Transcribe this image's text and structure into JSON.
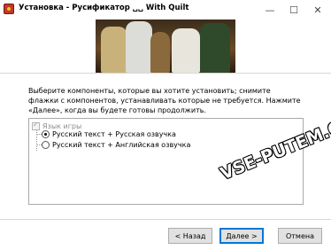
{
  "window": {
    "title": "Установка - Русификатор ␣␣ With Quilt",
    "controls": {
      "minimize": "—",
      "maximize": "☐",
      "close": "✕"
    }
  },
  "banner": {
    "icon": "game-cover-art"
  },
  "description": "Выберите компоненты, которые вы хотите установить; снимите флажки с компонентов, устанавливать которые не требуется. Нажмите «Далее», когда вы будете готовы продолжить.",
  "components": {
    "parent": {
      "label": "Язык игры",
      "checked": true,
      "disabled": true
    },
    "options": [
      {
        "label": "Русский текст + Русская озвучка",
        "selected": true
      },
      {
        "label": "Русский текст + Английская озвучка",
        "selected": false
      }
    ]
  },
  "watermark": "VSE-PUTEM.COM",
  "buttons": {
    "back": "< Назад",
    "next": "Далее >",
    "cancel": "Отмена"
  },
  "colors": {
    "accent": "#0078d7",
    "button_bg": "#e1e1e1"
  }
}
